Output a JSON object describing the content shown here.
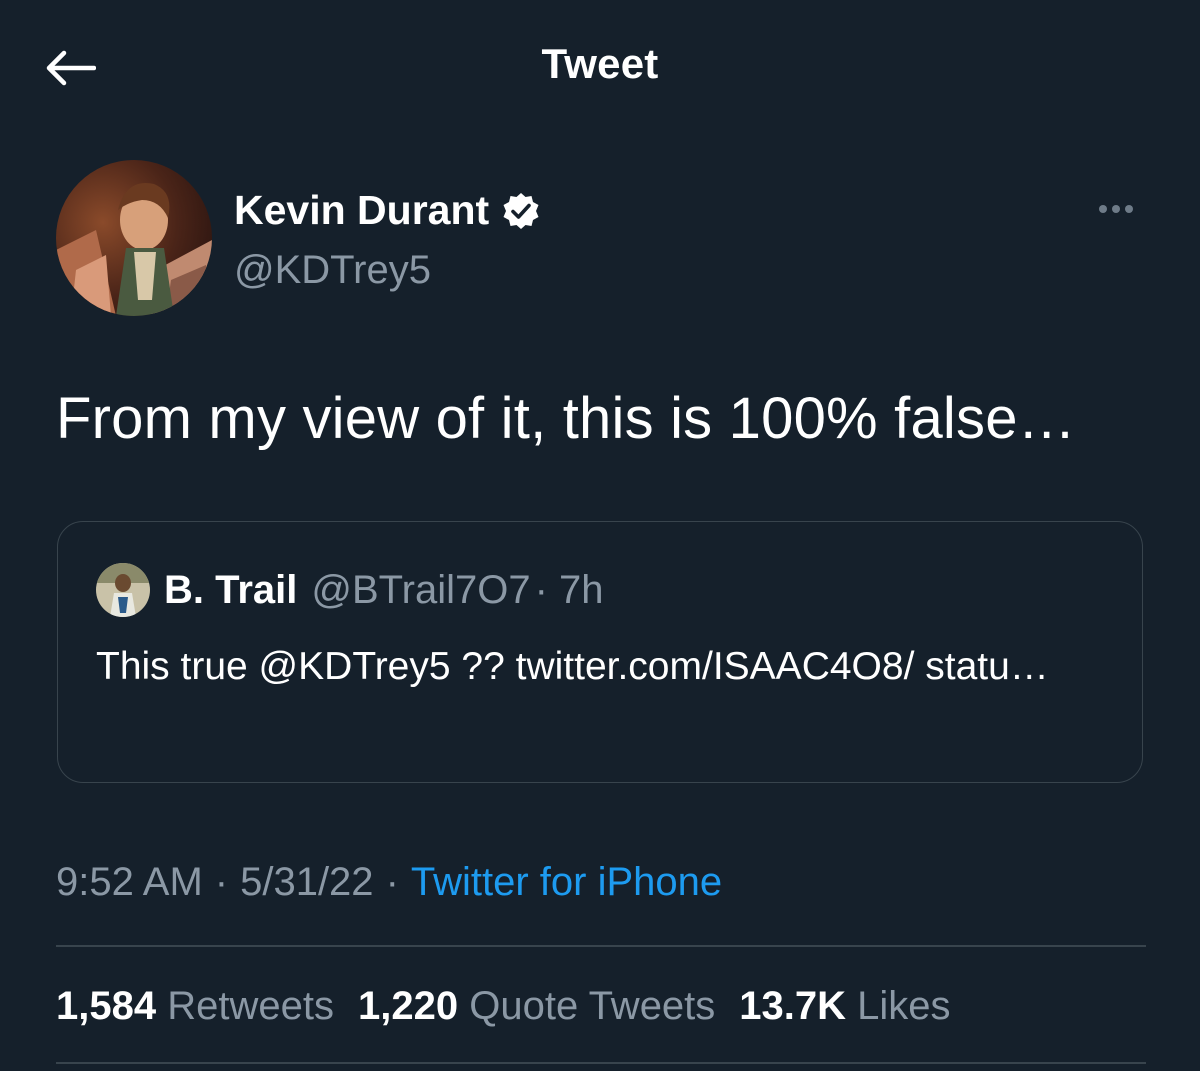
{
  "header": {
    "title": "Tweet",
    "back_icon": "arrow-left-icon"
  },
  "author": {
    "name": "Kevin Durant",
    "handle": "@KDTrey5",
    "verified_icon": "verified-badge-icon",
    "avatar": "animated-character-avatar"
  },
  "tweet": {
    "text": "From my view of it, this is 100% false…"
  },
  "quote": {
    "name": "B. Trail",
    "handle": "@BTrail7O7",
    "time": "· 7h",
    "text": "This true @KDTrey5 ?? twitter.com/ISAAC4O8/ statu…"
  },
  "meta": {
    "time": "9:52 AM",
    "sep1": "·",
    "date": "5/31/22",
    "sep2": "·",
    "source": "Twitter for iPhone"
  },
  "stats": [
    {
      "count": "1,584",
      "label": "Retweets"
    },
    {
      "count": "1,220",
      "label": "Quote Tweets"
    },
    {
      "count": "13.7K",
      "label": "Likes"
    }
  ],
  "colors": {
    "background": "#15202b",
    "secondary_text": "#8b98a5",
    "accent": "#1d9bf0",
    "border": "#38444d"
  }
}
